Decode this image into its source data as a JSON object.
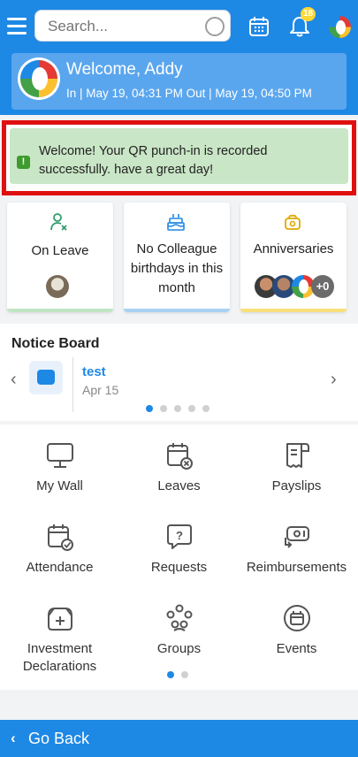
{
  "header": {
    "search_placeholder": "Search...",
    "notification_count": "18"
  },
  "welcome": {
    "title": "Welcome, Addy",
    "times": "In | May 19, 04:31 PM   Out | May 19, 04:50 PM"
  },
  "alert": {
    "icon": "!",
    "message": "Welcome! Your QR punch-in is recorded successfully. have a great day!"
  },
  "stats": [
    {
      "label": "On Leave",
      "accent": "#bfe6c3"
    },
    {
      "label": "No Colleague birthdays in this month",
      "accent": "#a9d2f3"
    },
    {
      "label": "Anniversaries",
      "accent": "#f7e07a",
      "extra": "+0"
    }
  ],
  "notice_board": {
    "title": "Notice Board",
    "item": {
      "title": "test",
      "date": "Apr 15"
    }
  },
  "modules": [
    {
      "label": "My Wall",
      "icon": "monitor-icon"
    },
    {
      "label": "Leaves",
      "icon": "calendar-cancel-icon"
    },
    {
      "label": "Payslips",
      "icon": "receipt-icon"
    },
    {
      "label": "Attendance",
      "icon": "calendar-check-icon"
    },
    {
      "label": "Requests",
      "icon": "question-bubble-icon"
    },
    {
      "label": "Reimbursements",
      "icon": "money-exchange-icon"
    },
    {
      "label": "Investment Declarations",
      "icon": "investment-bag-icon"
    },
    {
      "label": "Groups",
      "icon": "group-icon"
    },
    {
      "label": "Events",
      "icon": "event-icon"
    }
  ],
  "footer": {
    "back_label": "Go Back"
  },
  "colors": {
    "primary": "#1e88e5",
    "alert_bg": "#c9e6c6",
    "alert_border": "#e01010"
  }
}
